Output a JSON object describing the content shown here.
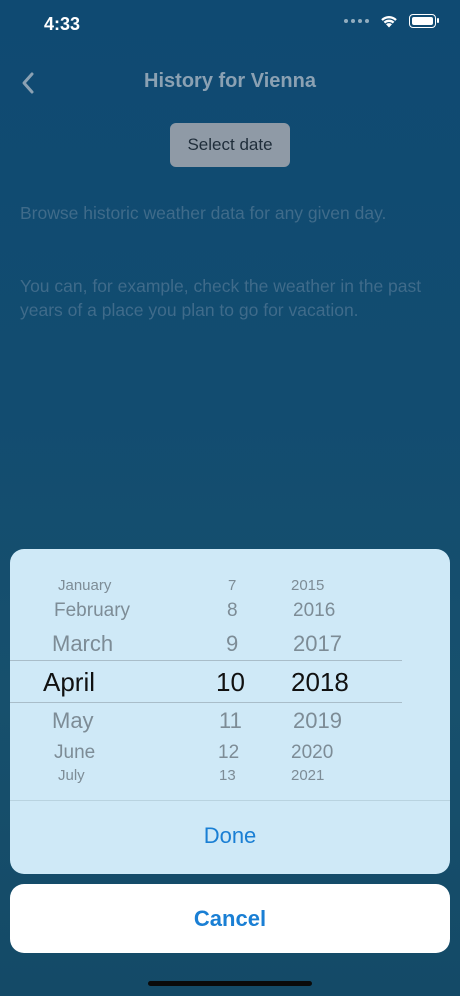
{
  "status_bar": {
    "time": "4:33"
  },
  "nav": {
    "title": "History for Vienna"
  },
  "actions": {
    "select_date_label": "Select date"
  },
  "description": {
    "paragraph1": "Browse historic weather data for any given day.",
    "paragraph2": "You can, for example, check the weather in the past years of a place you plan to go for vacation."
  },
  "picker": {
    "months": [
      "January",
      "February",
      "March",
      "April",
      "May",
      "June",
      "July"
    ],
    "days": [
      "7",
      "8",
      "9",
      "10",
      "11",
      "12",
      "13"
    ],
    "years": [
      "2015",
      "2016",
      "2017",
      "2018",
      "2019",
      "2020",
      "2021"
    ],
    "selected_month": "April",
    "selected_day": "10",
    "selected_year": "2018",
    "done_label": "Done"
  },
  "cancel_label": "Cancel"
}
